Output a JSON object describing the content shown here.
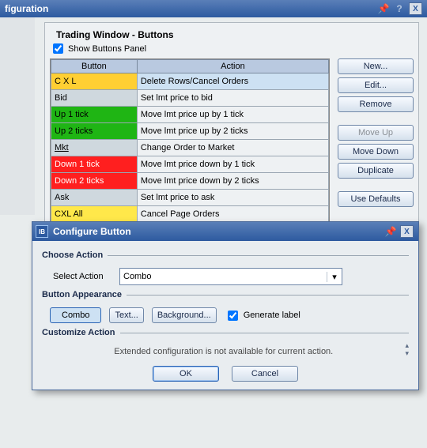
{
  "window": {
    "title": "figuration"
  },
  "section": {
    "title": "Trading Window - Buttons",
    "show_panel_label": "Show Buttons Panel",
    "show_panel_checked": true,
    "headers": {
      "button": "Button",
      "action": "Action"
    },
    "rows": [
      {
        "btn": "C X L",
        "act": "Delete Rows/Cancel Orders",
        "cls": "c-yel sel"
      },
      {
        "btn": "Bid",
        "act": "Set lmt price to bid",
        "cls": "c-bid"
      },
      {
        "btn": "Up 1 tick",
        "act": "Move lmt price up by 1 tick",
        "cls": "c-grn"
      },
      {
        "btn": "Up 2 ticks",
        "act": "Move lmt price up by 2 ticks",
        "cls": "c-grn"
      },
      {
        "btn": "Mkt",
        "act": "Change Order to Market",
        "cls": "c-mkt"
      },
      {
        "btn": "Down 1 tick",
        "act": "Move lmt price down by 1 tick",
        "cls": "c-red"
      },
      {
        "btn": "Down 2 ticks",
        "act": "Move lmt price down by 2 ticks",
        "cls": "c-red"
      },
      {
        "btn": "Ask",
        "act": "Set lmt price to ask",
        "cls": "c-ask"
      },
      {
        "btn": "CXL All",
        "act": "Cancel Page Orders",
        "cls": "c-yel"
      }
    ]
  },
  "side_buttons": {
    "new": "New...",
    "edit": "Edit...",
    "remove": "Remove",
    "move_up": "Move Up",
    "move_down": "Move Down",
    "duplicate": "Duplicate",
    "use_defaults": "Use Defaults"
  },
  "dialog": {
    "title": "Configure Button",
    "choose_action": "Choose Action",
    "select_action_label": "Select Action",
    "select_action_value": "Combo",
    "appearance": "Button Appearance",
    "preview": "Combo",
    "text_btn": "Text...",
    "background_btn": "Background...",
    "generate_label": "Generate label",
    "generate_checked": true,
    "customize": "Customize Action",
    "note": "Extended configuration is not available for current action.",
    "ok": "OK",
    "cancel": "Cancel"
  }
}
